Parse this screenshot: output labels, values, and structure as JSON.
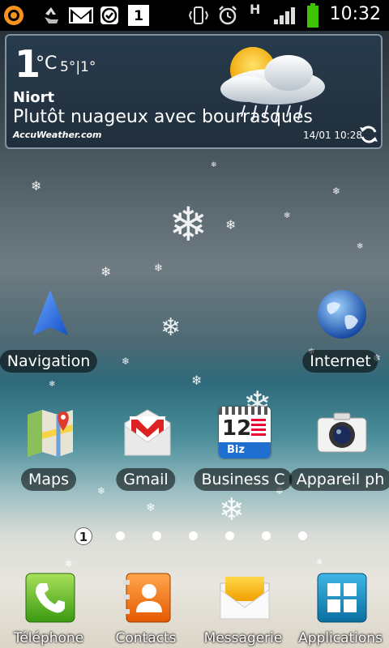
{
  "status_bar": {
    "time": "10:32",
    "icons": [
      "avast-icon",
      "recycle-icon",
      "gmail-icon",
      "check-task-icon",
      "calendar-icon",
      "vibrate-icon",
      "alarm-icon",
      "h-data-icon",
      "signal-icon",
      "battery-icon"
    ],
    "data_type": "H",
    "calendar_day": "1"
  },
  "weather": {
    "temp": "1",
    "unit": "°C",
    "minmax": "5°|1°",
    "city": "Niort",
    "condition": "Plutôt nuageux avec bourrasques",
    "provider": "AccuWeather.com",
    "updated": "14/01 10:28",
    "icon": "cloud-snow-sun-icon"
  },
  "apps_row1": [
    {
      "label": "Navigation",
      "icon": "navigation-icon"
    },
    {
      "label": "Internet",
      "icon": "internet-globe-icon"
    }
  ],
  "apps_row2": [
    {
      "label": "Maps",
      "icon": "maps-icon"
    },
    {
      "label": "Gmail",
      "icon": "gmail-app-icon"
    },
    {
      "label": "Business C",
      "icon": "business-calendar-icon",
      "badge": "12",
      "badge_text": "Biz"
    },
    {
      "label": "Appareil ph",
      "icon": "camera-icon"
    }
  ],
  "page_indicator": {
    "current": "1",
    "total": 7
  },
  "dock": [
    {
      "label": "Téléphone",
      "icon": "phone-icon"
    },
    {
      "label": "Contacts",
      "icon": "contacts-icon"
    },
    {
      "label": "Messagerie",
      "icon": "messaging-icon"
    },
    {
      "label": "Applications",
      "icon": "apps-grid-icon"
    }
  ],
  "colors": {
    "battery": "#3ec300",
    "status_bg": "#000000",
    "label_bg": "#000000"
  }
}
